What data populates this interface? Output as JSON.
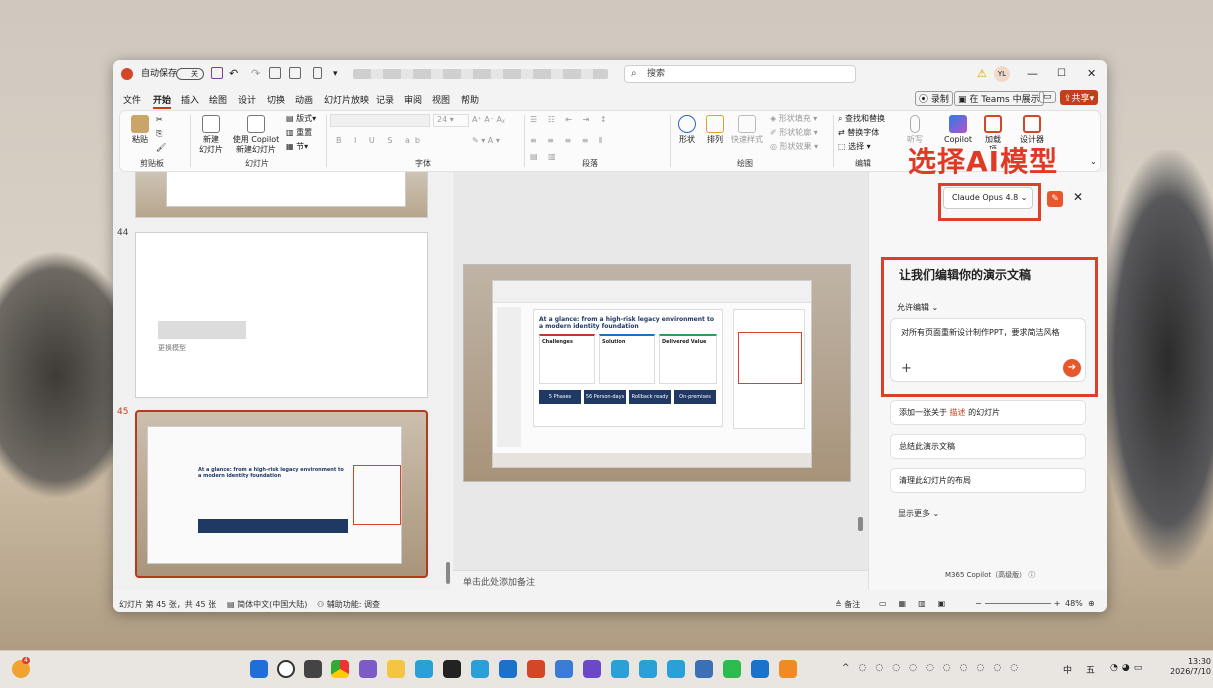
{
  "app": {
    "autosave_label": "自动保存",
    "autosave_state": "关",
    "search_placeholder": "搜索",
    "user_initials": "YL"
  },
  "menu": [
    "文件",
    "开始",
    "插入",
    "绘图",
    "设计",
    "切换",
    "动画",
    "幻灯片放映",
    "记录",
    "审阅",
    "视图",
    "帮助"
  ],
  "menu_right": {
    "record": "录制",
    "teams": "在 Teams 中展示",
    "share": "共享"
  },
  "ribbon": {
    "clipboard": {
      "paste": "粘贴",
      "group": "剪贴板"
    },
    "slides": {
      "new_slide": "新建\n幻灯片",
      "copilot": "使用 Copilot\n新建幻灯片",
      "layout": "版式",
      "reset": "重置",
      "section": "节",
      "group": "幻灯片"
    },
    "font": {
      "size": "24",
      "group": "字体"
    },
    "paragraph": {
      "group": "段落"
    },
    "drawing": {
      "shape": "形状",
      "arrange": "排列",
      "quick": "快速样式",
      "fill": "形状填充",
      "outline": "形状轮廓",
      "effect": "形状效果",
      "group": "绘图"
    },
    "editing": {
      "find": "查找和替换",
      "replace": "替换字体",
      "select": "选择",
      "group": "编辑"
    },
    "right": {
      "dictate": "听写",
      "copilot": "Copilot",
      "addin": "加载项",
      "designer": "设计器"
    }
  },
  "thumbs": [
    {
      "num": "44",
      "placeholder": "更换模型"
    },
    {
      "num": "45",
      "title": "At a glance: from a high-risk legacy environment to a modern identity foundation"
    }
  ],
  "slide": {
    "title": "At a glance: from a high-risk legacy environment to a modern identity foundation",
    "cards": [
      "Challenges",
      "Solution",
      "Delivered Value"
    ],
    "stats": [
      "5 Phases",
      "56 Person-days",
      "Rollback ready",
      "On-premises"
    ]
  },
  "notes_placeholder": "单击此处添加备注",
  "copilot": {
    "model": "Claude Opus 4.8",
    "heading": "让我们编辑你的演示文稿",
    "permission": "允许编辑",
    "prompt": "对所有页面重新设计制作PPT，要求简洁风格",
    "suggestions": [
      "添加一张关于",
      "描述",
      "的幻灯片",
      "总结此演示文稿",
      "清理此幻灯片的布局"
    ],
    "more": "显示更多",
    "footer": "M365 Copilot（高级版）"
  },
  "overlay_label": "选择AI模型",
  "status": {
    "slide_count": "幻灯片 第 45 张，共 45 张",
    "language": "简体中文(中国大陆)",
    "accessibility": "辅助功能: 调查",
    "notes": "备注",
    "zoom": "48%"
  },
  "taskbar": {
    "time": "13:30",
    "date": "2026/7/10",
    "ime1": "中",
    "ime2": "五",
    "badge": "4"
  },
  "colors": {
    "accent": "#c43e1c",
    "highlight": "#d9412b",
    "copilot_send": "#e8562b"
  }
}
